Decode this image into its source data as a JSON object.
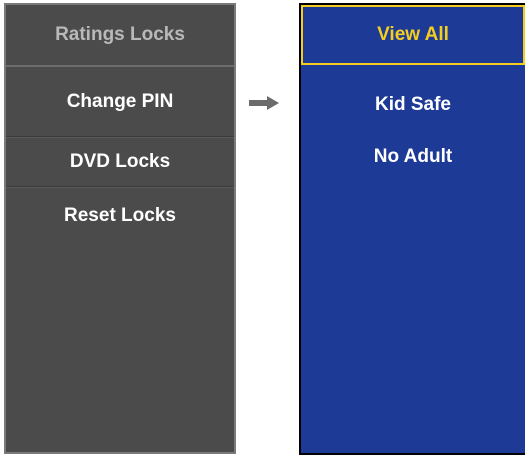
{
  "left_menu": {
    "title": "Ratings Locks",
    "items": [
      {
        "label": "Change PIN"
      },
      {
        "label": "DVD Locks"
      },
      {
        "label": "Reset Locks"
      }
    ]
  },
  "arrow_icon": "right-arrow-icon",
  "right_menu": {
    "items": [
      {
        "label": "View All",
        "selected": true
      },
      {
        "label": "Kid Safe"
      },
      {
        "label": "No Adult"
      }
    ]
  },
  "colors": {
    "left_panel_bg": "#4b4b4b",
    "right_panel_bg": "#1d3a96",
    "highlight": "#f5cd1c"
  }
}
